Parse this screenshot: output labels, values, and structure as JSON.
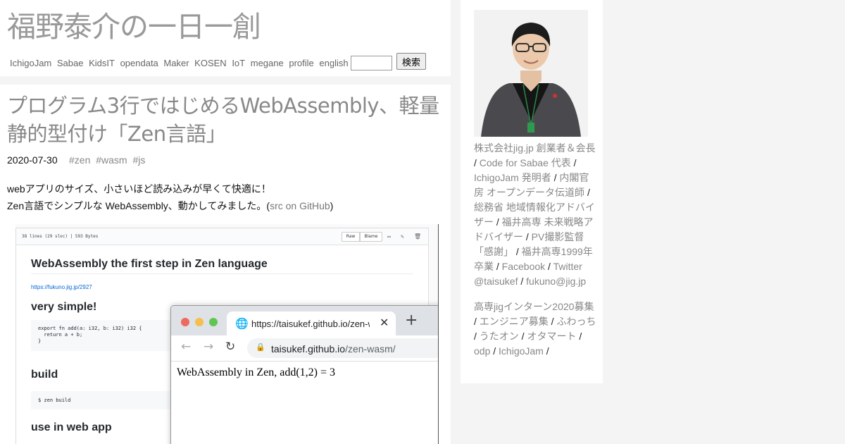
{
  "header": {
    "site_title": "福野泰介の一日一創",
    "tags": [
      "IchigoJam",
      "Sabae",
      "KidsIT",
      "opendata",
      "Maker",
      "KOSEN",
      "IoT",
      "megane",
      "profile",
      "english"
    ],
    "search_button": "検索",
    "search_value": ""
  },
  "post": {
    "title": "プログラム3行ではじめるWebAssembly、軽量静的型付け「Zen言語」",
    "date": "2020-07-30",
    "tags": [
      "#zen",
      "#wasm",
      "#js"
    ],
    "line1": "webアプリのサイズ、小さいほど読み込みが早くて快適に！",
    "line2_prefix": "Zen言語でシンプルな WebAssembly、動かしてみました。(",
    "line2_link": "src on GitHub",
    "line2_suffix": ")"
  },
  "screenshot": {
    "file_meta": "38 lines (29 sloc)  |  593 Bytes",
    "raw": "Raw",
    "blame": "Blame",
    "readme_title": "WebAssembly the first step in Zen language",
    "readme_link": "https://fukuno.jig.jp/2927",
    "h_simple": "very simple!",
    "code1": "export fn add(a: i32, b: i32) i32 {\n  return a + b;\n}",
    "h_build": "build",
    "code2": "$ zen build",
    "h_use": "use in web app",
    "browser": {
      "tab_title": "https://taisukef.github.io/zen-w",
      "url_host": "taisukef.github.io",
      "url_path": "/zen-wasm/",
      "content": "WebAssembly in Zen, add(1,2) = 3"
    }
  },
  "sidebar": {
    "bio": [
      {
        "t": "株式会社jig.jp 創業者＆会長"
      },
      {
        "s": " / "
      },
      {
        "t": "Code for Sabae 代表"
      },
      {
        "s": " / "
      },
      {
        "t": "IchigoJam 発明者"
      },
      {
        "s": " / "
      },
      {
        "t": "内閣官房 オープンデータ伝道師"
      },
      {
        "s": " / "
      },
      {
        "t": "総務省 地域情報化アドバイザー"
      },
      {
        "s": " / "
      },
      {
        "t": "福井高専 未来戦略アドバイザー"
      },
      {
        "s": " / "
      },
      {
        "t": "PV撮影監督「感謝」"
      },
      {
        "s": " / "
      },
      {
        "t": "福井高専1999年卒業"
      },
      {
        "s": " / "
      },
      {
        "t": "Facebook"
      },
      {
        "s": " / "
      },
      {
        "t": "Twitter @taisukef"
      },
      {
        "s": " / "
      },
      {
        "t": "fukuno@jig.jp"
      }
    ],
    "links": [
      {
        "t": "高専jigインターン2020募集"
      },
      {
        "s": " / "
      },
      {
        "t": "エンジニア募集"
      },
      {
        "s": " / "
      },
      {
        "t": "ふわっち"
      },
      {
        "s": " / "
      },
      {
        "t": "うたオン"
      },
      {
        "s": " / "
      },
      {
        "t": "オタマート"
      },
      {
        "s": " / "
      },
      {
        "t": "odp"
      },
      {
        "s": " / "
      },
      {
        "t": "IchigoJam"
      },
      {
        "s": " /"
      }
    ]
  }
}
